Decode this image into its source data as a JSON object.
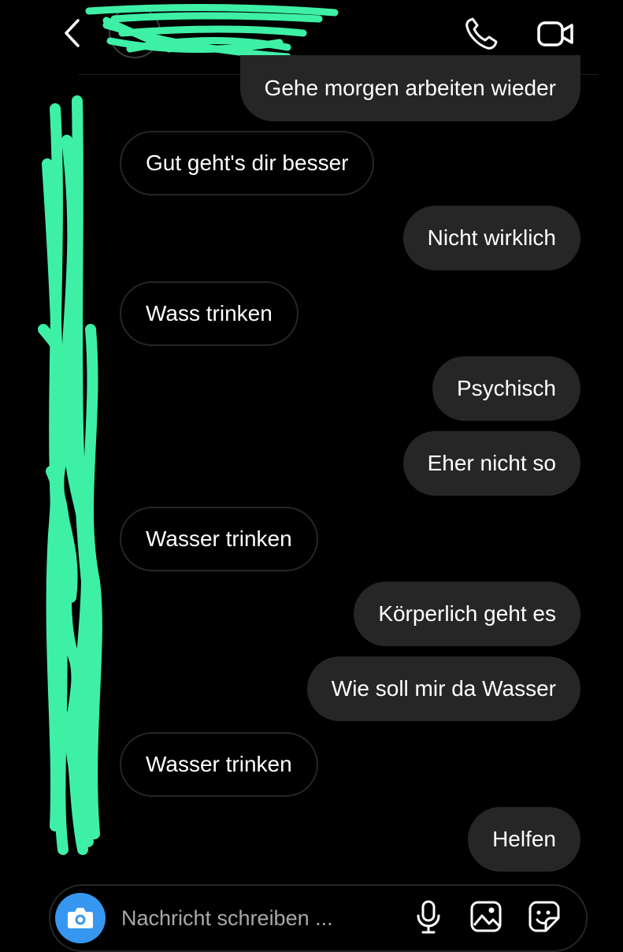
{
  "header": {
    "back_icon": "chevron-left-icon",
    "call_icon": "phone-icon",
    "video_icon": "video-camera-icon"
  },
  "messages": [
    {
      "side": "out",
      "text": "Gehe morgen arbeiten wieder"
    },
    {
      "side": "in",
      "text": "Gut geht's dir besser"
    },
    {
      "side": "out",
      "text": "Nicht wirklich"
    },
    {
      "side": "in",
      "text": "Wass trinken"
    },
    {
      "side": "out",
      "text": "Psychisch"
    },
    {
      "side": "out",
      "text": "Eher nicht so"
    },
    {
      "side": "in",
      "text": "Wasser trinken"
    },
    {
      "side": "out",
      "text": "Körperlich geht es"
    },
    {
      "side": "out",
      "text": "Wie soll mir da Wasser"
    },
    {
      "side": "in",
      "text": "Wasser trinken"
    },
    {
      "side": "out",
      "text": "Helfen"
    }
  ],
  "composer": {
    "placeholder": "Nachricht schreiben ...",
    "camera_icon": "camera-icon",
    "mic_icon": "microphone-icon",
    "gallery_icon": "image-gallery-icon",
    "sticker_icon": "sticker-icon"
  },
  "colors": {
    "background": "#000000",
    "bubble_out": "#262626",
    "bubble_in_border": "#262626",
    "camera_button": "#3797f0",
    "redaction": "#3ef0a6"
  }
}
